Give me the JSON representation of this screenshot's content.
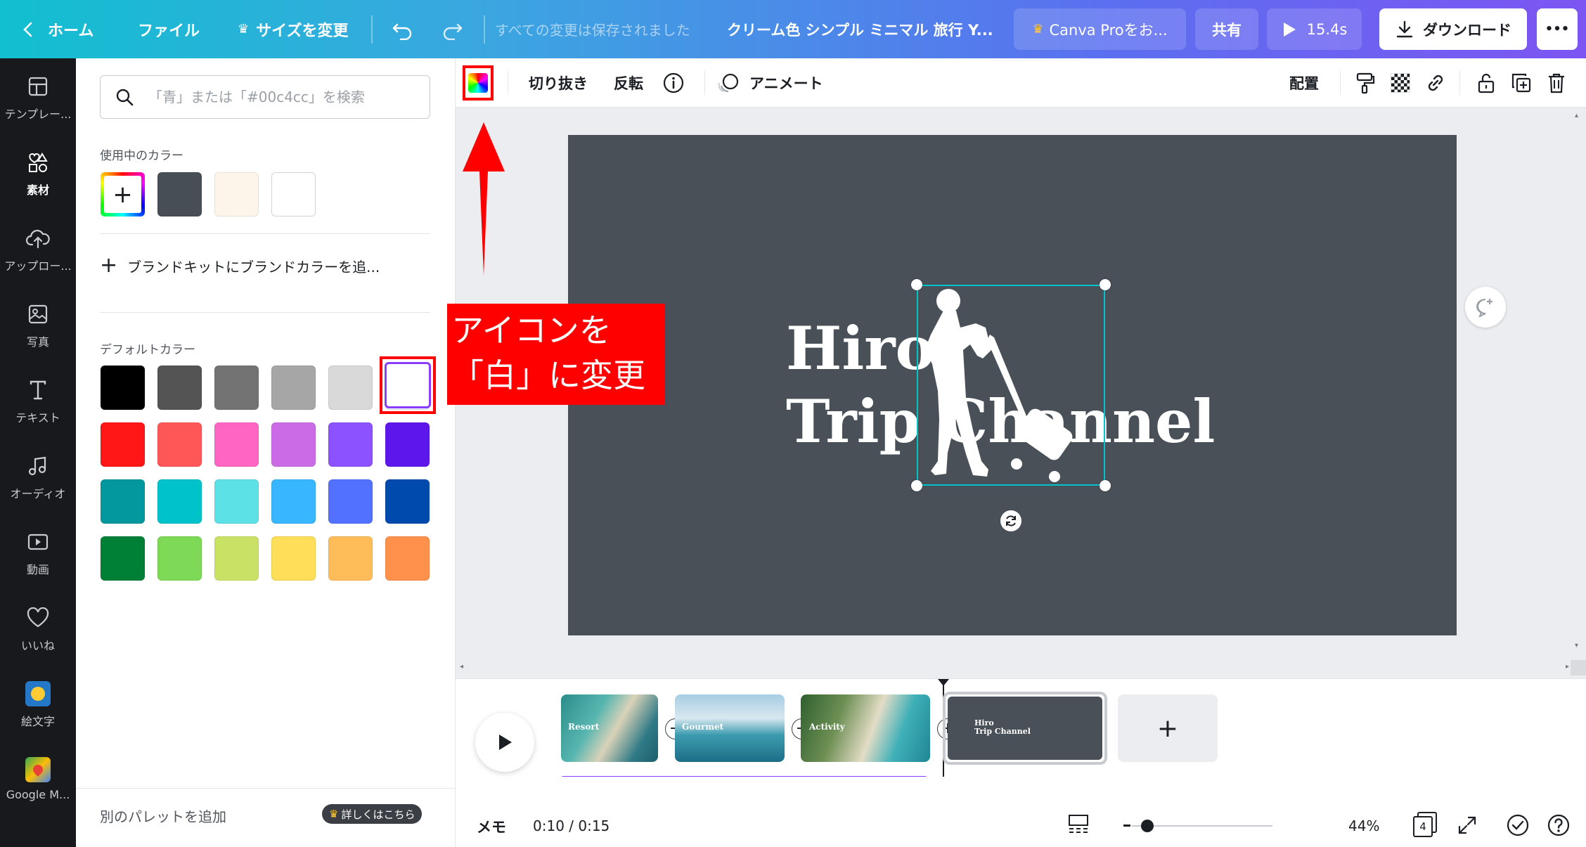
{
  "topbar": {
    "home": "ホーム",
    "file": "ファイル",
    "resize": "サイズを変更",
    "saved_status": "すべての変更は保存されました",
    "doc_title": "クリーム色 シンプル ミニマル 旅行 Y...",
    "pro_button": "Canva Proをお...",
    "share": "共有",
    "play_duration": "15.4s",
    "download": "ダウンロード",
    "more": "•••"
  },
  "rail": {
    "items": [
      {
        "label": "テンプレー..."
      },
      {
        "label": "素材"
      },
      {
        "label": "アップロー..."
      },
      {
        "label": "写真"
      },
      {
        "label": "テキスト"
      },
      {
        "label": "オーディオ"
      },
      {
        "label": "動画"
      },
      {
        "label": "いいね"
      },
      {
        "label": "絵文字"
      },
      {
        "label": "Google M..."
      }
    ]
  },
  "panel": {
    "search_placeholder": "「青」または「#00c4cc」を検索",
    "in_use_title": "使用中のカラー",
    "in_use_colors": [
      "#474e56",
      "#fdf5ea",
      "#ffffff"
    ],
    "brand_add": "ブランドキットにブランドカラーを追...",
    "default_title": "デフォルトカラー",
    "default_colors": [
      "#000000",
      "#545454",
      "#737373",
      "#a6a6a6",
      "#d9d9d9",
      "#ffffff",
      "#ff1616",
      "#ff5757",
      "#ff66c4",
      "#cb6ce6",
      "#8c52ff",
      "#5e17eb",
      "#03989e",
      "#00c2cb",
      "#5ce1e6",
      "#38b6ff",
      "#5271ff",
      "#004aad",
      "#008037",
      "#7ed957",
      "#c9e265",
      "#ffde59",
      "#ffbd59",
      "#ff914d"
    ],
    "add_palette": "別のパレットを追加",
    "learn_more": "詳しくはこちら"
  },
  "toolbar": {
    "crop": "切り抜き",
    "flip": "反転",
    "animate": "アニメート",
    "position": "配置"
  },
  "slide": {
    "line1": "Hiro",
    "line2": "Trip Channel",
    "background": "#495057"
  },
  "annotation": {
    "text": "アイコンを\n「白」に変更"
  },
  "timeline": {
    "thumbs": [
      "Resort",
      "Gourmet",
      "Activity",
      "Hiro\nTrip Channel"
    ]
  },
  "bottombar": {
    "notes": "メモ",
    "time": "0:10 / 0:15",
    "zoom": "44%",
    "page_count": "4"
  }
}
